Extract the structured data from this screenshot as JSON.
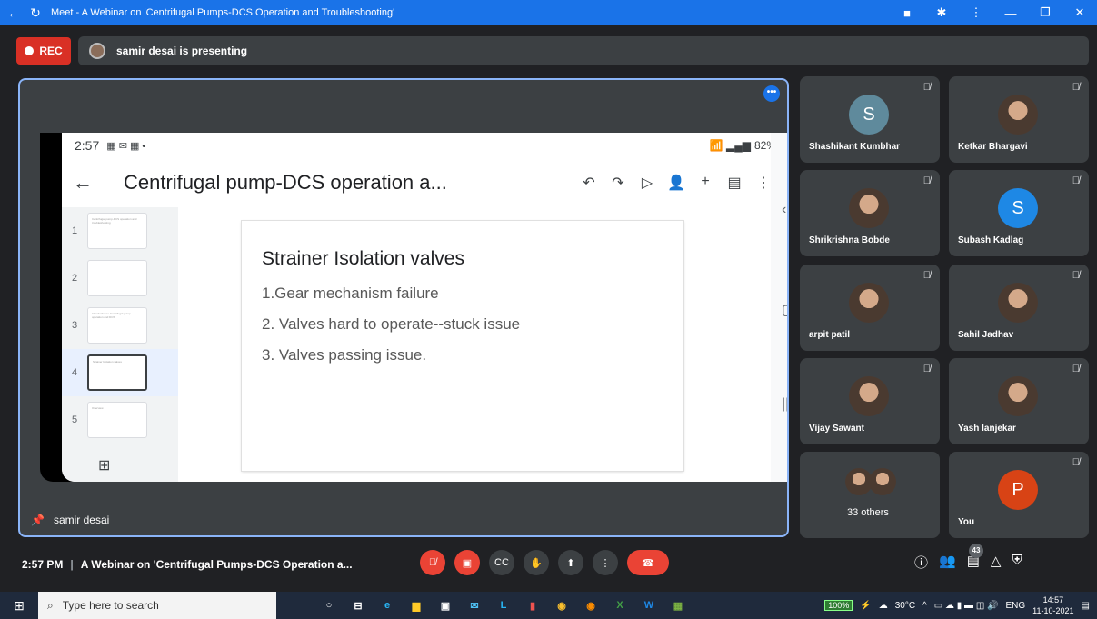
{
  "browser": {
    "title": "Meet - A Webinar on 'Centrifugal Pumps-DCS Operation and Troubleshooting'",
    "icons": [
      "back-arrow-icon",
      "reload-icon",
      "camera-icon",
      "extension-icon",
      "menu-dots-icon",
      "minimize-icon",
      "restore-icon",
      "close-icon"
    ]
  },
  "presentation": {
    "rec_label": "REC",
    "presenting_text": "samir desai is presenting",
    "presenter_name": "samir desai"
  },
  "phone": {
    "time": "2:57",
    "battery": "82%",
    "doc_title": "Centrifugal pump-DCS operation a...",
    "toolbar_icons": [
      "undo-icon",
      "redo-icon",
      "play-icon",
      "add-person-icon",
      "plus-icon",
      "comment-icon",
      "more-icon"
    ],
    "thumbnails": [
      {
        "num": "1",
        "text": "Centrifugal pump-DCS operation and troubleshooting"
      },
      {
        "num": "2",
        "text": ""
      },
      {
        "num": "3",
        "text": "Introduction to Centrifugal pump operation and DCS"
      },
      {
        "num": "4",
        "text": "Strainer Isolation valves"
      },
      {
        "num": "5",
        "text": "Overview"
      }
    ],
    "selected_slide": "4",
    "slide": {
      "heading": "Strainer Isolation valves",
      "points": [
        "1.Gear mechanism failure",
        "2. Valves hard to operate--stuck issue",
        "3. Valves passing issue."
      ]
    }
  },
  "participants": [
    {
      "name": "Shashikant Kumbhar",
      "initial": "S",
      "color": "#5f8a9c",
      "muted": true
    },
    {
      "name": "Ketkar Bhargavi",
      "initial": "",
      "color": "",
      "muted": true
    },
    {
      "name": "Shrikrishna Bobde",
      "initial": "",
      "color": "",
      "muted": true
    },
    {
      "name": "Subash Kadlag",
      "initial": "S",
      "color": "#1e88e5",
      "muted": true
    },
    {
      "name": "arpit patil",
      "initial": "",
      "color": "",
      "muted": true
    },
    {
      "name": "Sahil Jadhav",
      "initial": "",
      "color": "",
      "muted": true
    },
    {
      "name": "Vijay Sawant",
      "initial": "",
      "color": "",
      "muted": true
    },
    {
      "name": "Yash lanjekar",
      "initial": "",
      "color": "",
      "muted": true
    },
    {
      "name": "33 others",
      "initial": "",
      "color": "",
      "muted": false
    },
    {
      "name": "You",
      "initial": "P",
      "color": "#d84315",
      "muted": true
    }
  ],
  "bottom": {
    "time": "2:57 PM",
    "meeting_title": "A Webinar on 'Centrifugal Pumps-DCS Operation a...",
    "people_count": "43"
  },
  "taskbar": {
    "search_placeholder": "Type here to search",
    "battery": "100%",
    "weather": "30°C",
    "lang": "ENG",
    "time": "14:57",
    "date": "11-10-2021"
  }
}
